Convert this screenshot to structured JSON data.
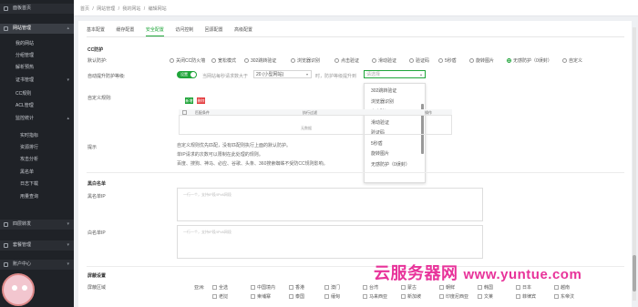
{
  "sidebar": {
    "items": [
      {
        "label": "面板首页",
        "kind": "top"
      },
      {
        "label": "网站管理",
        "kind": "top",
        "arrow": "▴"
      },
      {
        "label": "我的网站",
        "kind": "sub"
      },
      {
        "label": "分组管理",
        "kind": "sub"
      },
      {
        "label": "解析预热",
        "kind": "sub"
      },
      {
        "label": "证书管理",
        "kind": "sub",
        "arrow": "▾"
      },
      {
        "label": "CC规则",
        "kind": "sub"
      },
      {
        "label": "ACL管理",
        "kind": "sub"
      },
      {
        "label": "监控统计",
        "kind": "sub",
        "arrow": "▴"
      },
      {
        "label": "实时指标",
        "kind": "sub2"
      },
      {
        "label": "资源排行",
        "kind": "sub2"
      },
      {
        "label": "攻击分析",
        "kind": "sub2"
      },
      {
        "label": "黑名单",
        "kind": "sub2"
      },
      {
        "label": "日志下载",
        "kind": "sub2"
      },
      {
        "label": "用量查询",
        "kind": "sub2"
      },
      {
        "label": "四层转发",
        "kind": "top",
        "arrow": "▾"
      },
      {
        "label": "套餐管理",
        "kind": "top",
        "arrow": "▾"
      },
      {
        "label": "账户中心",
        "kind": "top",
        "arrow": "▾"
      }
    ]
  },
  "breadcrumb": [
    "首页",
    "/",
    "网站管理",
    "/",
    "我的网站",
    "/",
    "编辑网站"
  ],
  "tabs": [
    "基本配置",
    "缓存配置",
    "安全配置",
    "访问控制",
    "回源配置",
    "高级配置"
  ],
  "cc": {
    "section": "CC防护",
    "default_label": "默认防护:",
    "modes": [
      "关闭CC防火墙",
      "宽松模式",
      "302跳转验证",
      "浏览器识别",
      "点击验证",
      "滑动验证",
      "验证码",
      "5秒盾",
      "旋转图片",
      "无感防护（0误封）",
      "自定义"
    ],
    "selected_mode": "无感防护（0误封）",
    "auto_label": "自动提升防护等级:",
    "toggle_text": "设置",
    "when_text": "当网站每秒请求数大于",
    "threshold_value": "20 (小型网站)",
    "then_text": "时，防护等级提升到",
    "level_placeholder": "请选择",
    "dropdown_options": [
      "302跳转验证",
      "浏览器识别",
      "点击验证",
      "滑动验证",
      "验证码",
      "5秒盾",
      "旋转图片",
      "无感防护（0误封）"
    ],
    "custom_label": "自定义规则:",
    "add_btn": "新增",
    "del_btn": "删除",
    "table_headers": [
      "匹配条件",
      "执行过滤",
      "操作"
    ],
    "table_empty": "无数据",
    "tip_label": "提示",
    "tips": [
      "自定义规则优先匹配，没有匹配则执行上面的默认防护。",
      "单IP请求的次数可以限制在此处理的规则。",
      "百度、搜狗、神马、必应、谷歌、头条、360搜索蜘蛛不受防CC规则影响。"
    ]
  },
  "bw": {
    "section": "黑白名单",
    "white_label": "黑名单IP",
    "black_label": "白名单IP",
    "placeholder": "一行一个，支持IP段/IPv6网段",
    "placeholder2": "一行一个，支持IP段/IPv6网段"
  },
  "region": {
    "section": "屏蔽设置",
    "label": "屏蔽区域",
    "row1": [
      "亚洲:",
      "全选",
      "中国境内",
      "香港",
      "澳门",
      "台湾",
      "蒙古",
      "朝鲜",
      "韩国",
      "日本",
      "越南"
    ],
    "row2": [
      "",
      "老挝",
      "柬埔寨",
      "泰国",
      "缅甸",
      "马来西亚",
      "新加坡",
      "印度尼西亚",
      "文莱",
      "菲律宾",
      "东帝汶"
    ]
  },
  "watermark": {
    "cn": "云服务器网",
    "url": "www.yuntue.com"
  },
  "colors": {
    "accent": "#20a53a",
    "sidebar": "#1f2227",
    "danger": "#e4393c"
  }
}
